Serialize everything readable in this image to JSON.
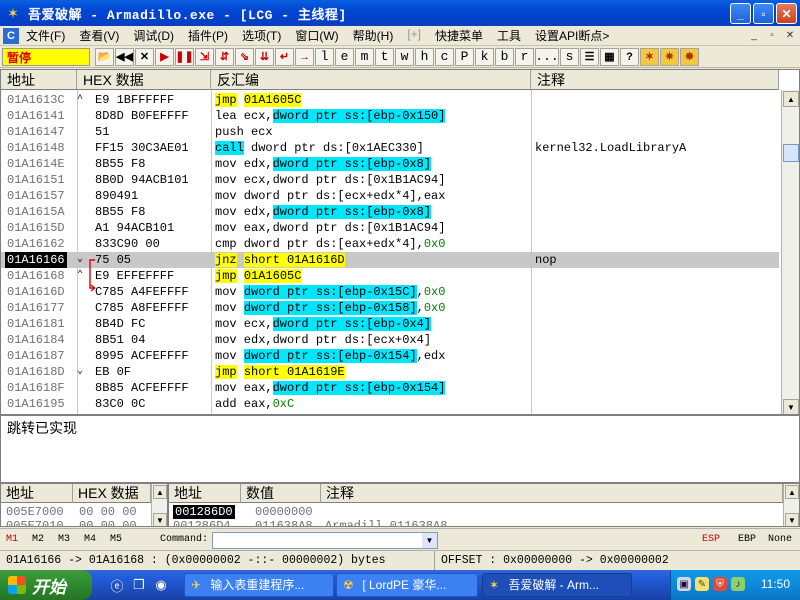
{
  "window": {
    "title": "吾爱破解 - Armadillo.exe - [LCG -  主线程]",
    "buttons": {
      "minimize": "_",
      "restore": "▫",
      "close": "✕"
    }
  },
  "menu": {
    "items": [
      {
        "label": "文件(F)"
      },
      {
        "label": "查看(V)"
      },
      {
        "label": "调试(D)"
      },
      {
        "label": "插件(P)"
      },
      {
        "label": "选项(T)"
      },
      {
        "label": "窗口(W)"
      },
      {
        "label": "帮助(H)"
      },
      {
        "label": "[+]",
        "gray": true
      },
      {
        "label": "快捷菜单"
      },
      {
        "label": "工具"
      },
      {
        "label": "设置API断点>"
      }
    ],
    "mdi_icon": "C",
    "mdi_controls": [
      "_",
      "▫",
      "✕"
    ]
  },
  "toolbar": {
    "status": "暂停",
    "buttons": [
      {
        "name": "open-icon",
        "glyph": "📂"
      },
      {
        "name": "rewind-icon",
        "glyph": "◀◀"
      },
      {
        "name": "close-icon",
        "glyph": "✕"
      },
      {
        "name": "run-icon",
        "glyph": "▶",
        "red": true
      },
      {
        "name": "pause-icon",
        "glyph": "❚❚",
        "red": true
      },
      {
        "name": "step-into-icon",
        "glyph": "⇲",
        "red": true
      },
      {
        "name": "step-over-icon",
        "glyph": "⇵",
        "red": true
      },
      {
        "name": "trace-into-icon",
        "glyph": "⇘",
        "red": true
      },
      {
        "name": "trace-over-icon",
        "glyph": "⇊",
        "red": true
      },
      {
        "name": "execute-till-return-icon",
        "glyph": "↵",
        "red": true
      },
      {
        "name": "goto-icon",
        "glyph": "→",
        "red": true
      },
      {
        "name": "letter-l",
        "glyph": "l",
        "letter": true
      },
      {
        "name": "letter-e",
        "glyph": "e",
        "letter": true
      },
      {
        "name": "letter-m",
        "glyph": "m",
        "letter": true
      },
      {
        "name": "letter-t",
        "glyph": "t",
        "letter": true
      },
      {
        "name": "letter-w",
        "glyph": "w",
        "letter": true
      },
      {
        "name": "letter-h",
        "glyph": "h",
        "letter": true
      },
      {
        "name": "letter-c",
        "glyph": "c",
        "letter": true
      },
      {
        "name": "letter-P",
        "glyph": "P",
        "letter": true
      },
      {
        "name": "letter-k",
        "glyph": "k",
        "letter": true
      },
      {
        "name": "letter-b",
        "glyph": "b",
        "letter": true
      },
      {
        "name": "letter-r",
        "glyph": "r",
        "letter": true
      },
      {
        "name": "ellipsis",
        "glyph": "...",
        "letter": true
      },
      {
        "name": "letter-s",
        "glyph": "s",
        "letter": true
      },
      {
        "name": "list-icon",
        "glyph": "☰"
      },
      {
        "name": "grid-icon",
        "glyph": "▦"
      },
      {
        "name": "help-icon",
        "glyph": "?"
      },
      {
        "name": "plugin-1-icon",
        "glyph": "✶",
        "warm": true
      },
      {
        "name": "plugin-2-icon",
        "glyph": "✷",
        "warm": true
      },
      {
        "name": "plugin-3-icon",
        "glyph": "✸",
        "warm": true
      }
    ]
  },
  "disasm": {
    "columns": [
      "地址",
      "HEX 数据",
      "反汇编",
      "注释"
    ],
    "rows": [
      {
        "addr": "01A1613C",
        "mark": "^",
        "hex": "E9 1BFFFFFF",
        "asm": [
          {
            "t": "jmp",
            "c": "y"
          },
          {
            "t": " "
          },
          {
            "t": "01A1605C",
            "c": "y"
          }
        ]
      },
      {
        "addr": "01A16141",
        "hex": "8D8D B0FEFFFF",
        "asm": [
          {
            "t": "lea ecx,"
          },
          {
            "t": "dword ptr ss:[ebp-0x150]",
            "c": "c"
          }
        ]
      },
      {
        "addr": "01A16147",
        "hex": "51",
        "asm": [
          {
            "t": "push ecx"
          }
        ]
      },
      {
        "addr": "01A16148",
        "hex": "FF15 30C3AE01",
        "asm": [
          {
            "t": "call",
            "c": "c"
          },
          {
            "t": " dword ptr ds:[0x1AEC330]"
          }
        ],
        "cmt": "kernel32.LoadLibraryA"
      },
      {
        "addr": "01A1614E",
        "hex": "8B55 F8",
        "asm": [
          {
            "t": "mov edx,"
          },
          {
            "t": "dword ptr ss:[ebp-0x8]",
            "c": "c"
          }
        ]
      },
      {
        "addr": "01A16151",
        "hex": "8B0D 94ACB101",
        "asm": [
          {
            "t": "mov ecx,dword ptr ds:[0x1B1AC94]"
          }
        ]
      },
      {
        "addr": "01A16157",
        "hex": "890491",
        "asm": [
          {
            "t": "mov dword ptr ds:[ecx+edx*4],eax"
          }
        ]
      },
      {
        "addr": "01A1615A",
        "hex": "8B55 F8",
        "asm": [
          {
            "t": "mov edx,"
          },
          {
            "t": "dword ptr ss:[ebp-0x8]",
            "c": "c"
          }
        ]
      },
      {
        "addr": "01A1615D",
        "hex": "A1 94ACB101",
        "asm": [
          {
            "t": "mov eax,dword ptr ds:[0x1B1AC94]"
          }
        ]
      },
      {
        "addr": "01A16162",
        "hex": "833C90 00",
        "asm": [
          {
            "t": "cmp dword ptr ds:[eax+edx*4],"
          },
          {
            "t": "0x0",
            "c": "n"
          }
        ]
      },
      {
        "addr": "01A16166",
        "mark": "⌄",
        "hex": "75 05",
        "asm": [
          {
            "t": "jnz",
            "c": "y"
          },
          {
            "t": " "
          },
          {
            "t": "short 01A1616D",
            "c": "y"
          }
        ],
        "cmt": "nop",
        "selected": true
      },
      {
        "addr": "01A16168",
        "mark": "⌃",
        "hex": "E9 EFFEFFFF",
        "asm": [
          {
            "t": "jmp",
            "c": "y"
          },
          {
            "t": " "
          },
          {
            "t": "01A1605C",
            "c": "y"
          }
        ]
      },
      {
        "addr": "01A1616D",
        "hex": "C785 A4FEFFFF",
        "asm": [
          {
            "t": "mov "
          },
          {
            "t": "dword ptr ss:[ebp-0x15C]",
            "c": "c"
          },
          {
            "t": ","
          },
          {
            "t": "0x0",
            "c": "n"
          }
        ]
      },
      {
        "addr": "01A16177",
        "hex": "C785 A8FEFFFF",
        "asm": [
          {
            "t": "mov "
          },
          {
            "t": "dword ptr ss:[ebp-0x158]",
            "c": "c"
          },
          {
            "t": ","
          },
          {
            "t": "0x0",
            "c": "n"
          }
        ]
      },
      {
        "addr": "01A16181",
        "hex": "8B4D FC",
        "asm": [
          {
            "t": "mov ecx,"
          },
          {
            "t": "dword ptr ss:[ebp-0x4]",
            "c": "c"
          }
        ]
      },
      {
        "addr": "01A16184",
        "hex": "8B51 04",
        "asm": [
          {
            "t": "mov edx,dword ptr ds:[ecx+0x4]"
          }
        ]
      },
      {
        "addr": "01A16187",
        "hex": "8995 ACFEFFFF",
        "asm": [
          {
            "t": "mov "
          },
          {
            "t": "dword ptr ss:[ebp-0x154]",
            "c": "c"
          },
          {
            "t": ",edx"
          }
        ]
      },
      {
        "addr": "01A1618D",
        "mark": "⌄",
        "hex": "EB 0F",
        "asm": [
          {
            "t": "jmp",
            "c": "y"
          },
          {
            "t": " "
          },
          {
            "t": "short 01A1619E",
            "c": "y"
          }
        ]
      },
      {
        "addr": "01A1618F",
        "hex": "8B85 ACFEFFFF",
        "asm": [
          {
            "t": "mov eax,"
          },
          {
            "t": "dword ptr ss:[ebp-0x154]",
            "c": "c"
          }
        ]
      },
      {
        "addr": "01A16195",
        "hex": "83C0 0C",
        "asm": [
          {
            "t": "add eax,"
          },
          {
            "t": "0xC",
            "c": "n"
          }
        ]
      }
    ]
  },
  "info": {
    "text": "跳转已实现"
  },
  "dump": {
    "columns": [
      "地址",
      "HEX 数据"
    ],
    "rows": [
      {
        "addr": "005E7000",
        "hex": "00 00 00"
      },
      {
        "addr": "005E7010",
        "hex": "00 00 00"
      }
    ]
  },
  "stack": {
    "columns": [
      "地址",
      "数值",
      "注释"
    ],
    "rows": [
      {
        "addr": "001286D0",
        "val": "00000000",
        "cmt": "",
        "selected": true
      },
      {
        "addr": "001286D4",
        "val": "011638A8",
        "cmt": "Armadill.011638A8"
      }
    ]
  },
  "cmdbar": {
    "tabs": [
      "M1",
      "M2",
      "M3",
      "M4",
      "M5"
    ],
    "label": "Command:",
    "registers": [
      "ESP",
      "EBP",
      "None"
    ]
  },
  "status": {
    "left": "01A16166 -> 01A16168 : (0x00000002  -::-   00000002) bytes",
    "right": "OFFSET : 0x00000000 -> 0x00000002"
  },
  "taskbar": {
    "start": "开始",
    "tasks": [
      {
        "label": "输入表重建程序...",
        "icon": "✈"
      },
      {
        "label": "[ LordPE 豪华...",
        "icon": "☢"
      },
      {
        "label": "吾爱破解 - Arm...",
        "icon": "✶",
        "active": true
      }
    ],
    "clock": "11:50"
  },
  "colors": {
    "highlight_yellow": "#FFFF00",
    "highlight_cyan": "#00E6FF",
    "number_green": "#008000",
    "selected_row": "#C8C8C8",
    "pause_text": "#E00000"
  }
}
